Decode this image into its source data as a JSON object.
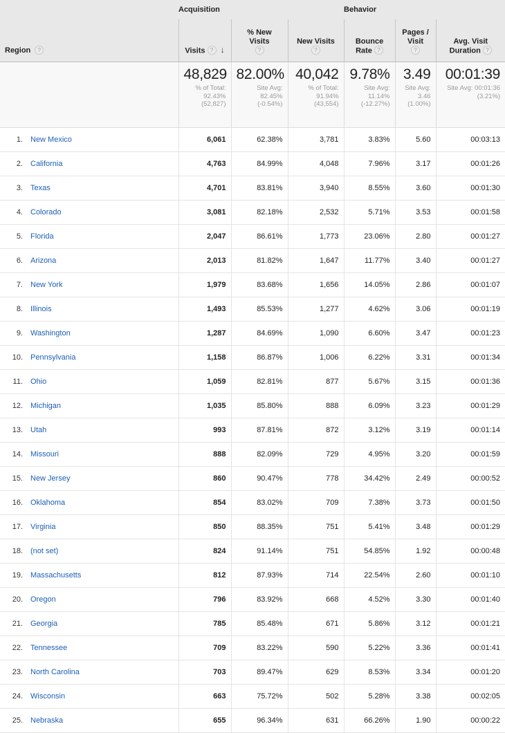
{
  "table": {
    "groups": {
      "region": "",
      "acquisition": "Acquisition",
      "behavior": "Behavior"
    },
    "columns": {
      "region": {
        "label": "Region",
        "help": "?"
      },
      "visits": {
        "label": "Visits",
        "help": "?",
        "sort_arrow": "↓"
      },
      "pct_new_visits": {
        "label": "% New Visits",
        "help": "?"
      },
      "new_visits": {
        "label": "New Visits",
        "help": "?"
      },
      "bounce_rate_line1": "Bounce",
      "bounce_rate_line2": "Rate",
      "bounce_rate": {
        "label": "Bounce Rate",
        "help": "?"
      },
      "pages_visit_line1": "Pages /",
      "pages_visit_line2": "Visit",
      "pages_visit": {
        "label": "Pages / Visit",
        "help": "?"
      },
      "avg_duration_line1": "Avg. Visit",
      "avg_duration_line2": "Duration",
      "avg_duration": {
        "label": "Avg. Visit Duration",
        "help": "?"
      }
    },
    "summary": {
      "visits": {
        "value": "48,829",
        "note": "% of Total: 92.43% (52,827)"
      },
      "pct_new_visits": {
        "value": "82.00%",
        "note": "Site Avg: 82.45% (-0.54%)"
      },
      "new_visits": {
        "value": "40,042",
        "note": "% of Total: 91.94% (43,554)"
      },
      "bounce_rate": {
        "value": "9.78%",
        "note": "Site Avg: 11.14% (-12.27%)"
      },
      "pages_visit": {
        "value": "3.49",
        "note": "Site Avg: 3.46 (1.00%)"
      },
      "avg_duration": {
        "value": "00:01:39",
        "note": "Site Avg: 00:01:36 (3.21%)"
      }
    },
    "rows": [
      {
        "index": "1.",
        "region": "New Mexico",
        "visits": "6,061",
        "pct_new_visits": "62.38%",
        "new_visits": "3,781",
        "bounce_rate": "3.83%",
        "pages_visit": "5.60",
        "avg_duration": "00:03:13"
      },
      {
        "index": "2.",
        "region": "California",
        "visits": "4,763",
        "pct_new_visits": "84.99%",
        "new_visits": "4,048",
        "bounce_rate": "7.96%",
        "pages_visit": "3.17",
        "avg_duration": "00:01:26"
      },
      {
        "index": "3.",
        "region": "Texas",
        "visits": "4,701",
        "pct_new_visits": "83.81%",
        "new_visits": "3,940",
        "bounce_rate": "8.55%",
        "pages_visit": "3.60",
        "avg_duration": "00:01:30"
      },
      {
        "index": "4.",
        "region": "Colorado",
        "visits": "3,081",
        "pct_new_visits": "82.18%",
        "new_visits": "2,532",
        "bounce_rate": "5.71%",
        "pages_visit": "3.53",
        "avg_duration": "00:01:58"
      },
      {
        "index": "5.",
        "region": "Florida",
        "visits": "2,047",
        "pct_new_visits": "86.61%",
        "new_visits": "1,773",
        "bounce_rate": "23.06%",
        "pages_visit": "2.80",
        "avg_duration": "00:01:27"
      },
      {
        "index": "6.",
        "region": "Arizona",
        "visits": "2,013",
        "pct_new_visits": "81.82%",
        "new_visits": "1,647",
        "bounce_rate": "11.77%",
        "pages_visit": "3.40",
        "avg_duration": "00:01:27"
      },
      {
        "index": "7.",
        "region": "New York",
        "visits": "1,979",
        "pct_new_visits": "83.68%",
        "new_visits": "1,656",
        "bounce_rate": "14.05%",
        "pages_visit": "2.86",
        "avg_duration": "00:01:07"
      },
      {
        "index": "8.",
        "region": "Illinois",
        "visits": "1,493",
        "pct_new_visits": "85.53%",
        "new_visits": "1,277",
        "bounce_rate": "4.62%",
        "pages_visit": "3.06",
        "avg_duration": "00:01:19"
      },
      {
        "index": "9.",
        "region": "Washington",
        "visits": "1,287",
        "pct_new_visits": "84.69%",
        "new_visits": "1,090",
        "bounce_rate": "6.60%",
        "pages_visit": "3.47",
        "avg_duration": "00:01:23"
      },
      {
        "index": "10.",
        "region": "Pennsylvania",
        "visits": "1,158",
        "pct_new_visits": "86.87%",
        "new_visits": "1,006",
        "bounce_rate": "6.22%",
        "pages_visit": "3.31",
        "avg_duration": "00:01:34"
      },
      {
        "index": "11.",
        "region": "Ohio",
        "visits": "1,059",
        "pct_new_visits": "82.81%",
        "new_visits": "877",
        "bounce_rate": "5.67%",
        "pages_visit": "3.15",
        "avg_duration": "00:01:36"
      },
      {
        "index": "12.",
        "region": "Michigan",
        "visits": "1,035",
        "pct_new_visits": "85.80%",
        "new_visits": "888",
        "bounce_rate": "6.09%",
        "pages_visit": "3.23",
        "avg_duration": "00:01:29"
      },
      {
        "index": "13.",
        "region": "Utah",
        "visits": "993",
        "pct_new_visits": "87.81%",
        "new_visits": "872",
        "bounce_rate": "3.12%",
        "pages_visit": "3.19",
        "avg_duration": "00:01:14"
      },
      {
        "index": "14.",
        "region": "Missouri",
        "visits": "888",
        "pct_new_visits": "82.09%",
        "new_visits": "729",
        "bounce_rate": "4.95%",
        "pages_visit": "3.20",
        "avg_duration": "00:01:59"
      },
      {
        "index": "15.",
        "region": "New Jersey",
        "visits": "860",
        "pct_new_visits": "90.47%",
        "new_visits": "778",
        "bounce_rate": "34.42%",
        "pages_visit": "2.49",
        "avg_duration": "00:00:52"
      },
      {
        "index": "16.",
        "region": "Oklahoma",
        "visits": "854",
        "pct_new_visits": "83.02%",
        "new_visits": "709",
        "bounce_rate": "7.38%",
        "pages_visit": "3.73",
        "avg_duration": "00:01:50"
      },
      {
        "index": "17.",
        "region": "Virginia",
        "visits": "850",
        "pct_new_visits": "88.35%",
        "new_visits": "751",
        "bounce_rate": "5.41%",
        "pages_visit": "3.48",
        "avg_duration": "00:01:29"
      },
      {
        "index": "18.",
        "region": "(not set)",
        "visits": "824",
        "pct_new_visits": "91.14%",
        "new_visits": "751",
        "bounce_rate": "54.85%",
        "pages_visit": "1.92",
        "avg_duration": "00:00:48"
      },
      {
        "index": "19.",
        "region": "Massachusetts",
        "visits": "812",
        "pct_new_visits": "87.93%",
        "new_visits": "714",
        "bounce_rate": "22.54%",
        "pages_visit": "2.60",
        "avg_duration": "00:01:10"
      },
      {
        "index": "20.",
        "region": "Oregon",
        "visits": "796",
        "pct_new_visits": "83.92%",
        "new_visits": "668",
        "bounce_rate": "4.52%",
        "pages_visit": "3.30",
        "avg_duration": "00:01:40"
      },
      {
        "index": "21.",
        "region": "Georgia",
        "visits": "785",
        "pct_new_visits": "85.48%",
        "new_visits": "671",
        "bounce_rate": "5.86%",
        "pages_visit": "3.12",
        "avg_duration": "00:01:21"
      },
      {
        "index": "22.",
        "region": "Tennessee",
        "visits": "709",
        "pct_new_visits": "83.22%",
        "new_visits": "590",
        "bounce_rate": "5.22%",
        "pages_visit": "3.36",
        "avg_duration": "00:01:41"
      },
      {
        "index": "23.",
        "region": "North Carolina",
        "visits": "703",
        "pct_new_visits": "89.47%",
        "new_visits": "629",
        "bounce_rate": "8.53%",
        "pages_visit": "3.34",
        "avg_duration": "00:01:20"
      },
      {
        "index": "24.",
        "region": "Wisconsin",
        "visits": "663",
        "pct_new_visits": "75.72%",
        "new_visits": "502",
        "bounce_rate": "5.28%",
        "pages_visit": "3.38",
        "avg_duration": "00:02:05"
      },
      {
        "index": "25.",
        "region": "Nebraska",
        "visits": "655",
        "pct_new_visits": "96.34%",
        "new_visits": "631",
        "bounce_rate": "66.26%",
        "pages_visit": "1.90",
        "avg_duration": "00:00:22"
      }
    ]
  },
  "colors": {
    "link": "#1c5fb4",
    "header_bg": "#e8e8e8",
    "summary_bg": "#f8f8f8",
    "sorted_column_bg": "#f8f8f8"
  }
}
